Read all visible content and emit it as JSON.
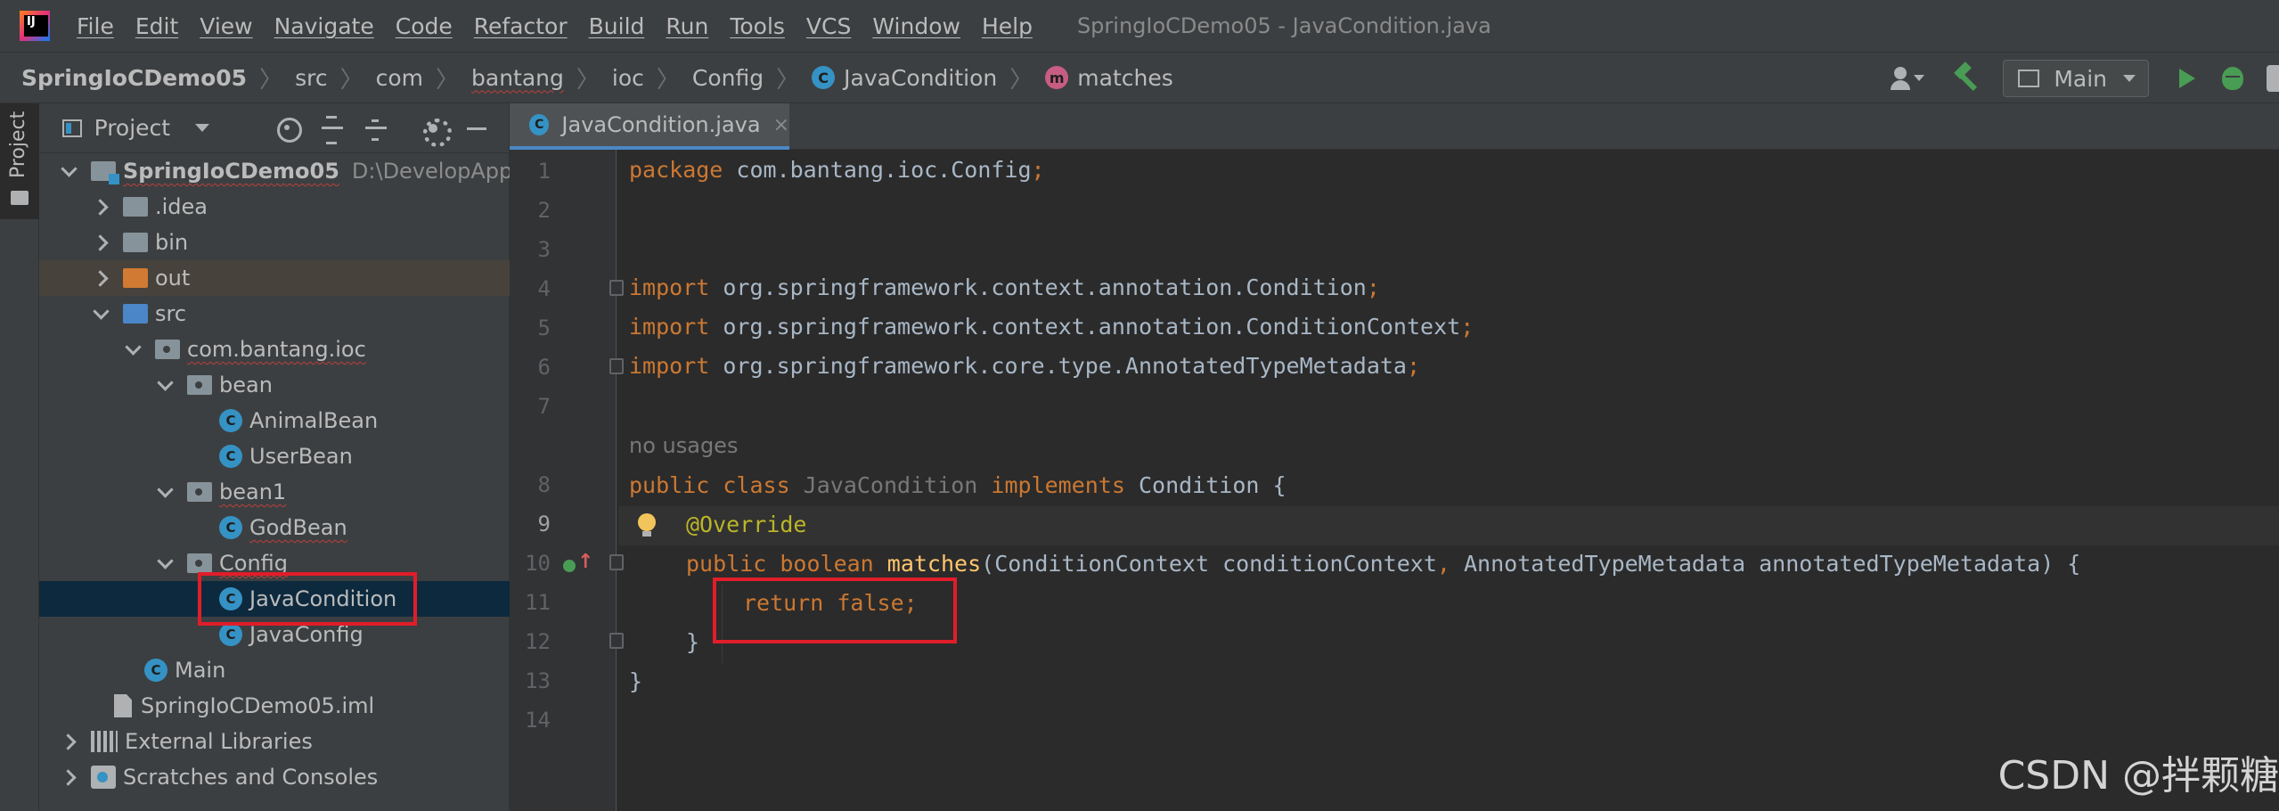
{
  "app": {
    "logo": "intellij-idea-logo",
    "window_title": "SpringIoCDemo05 - JavaCondition.java"
  },
  "menu": [
    "File",
    "Edit",
    "View",
    "Navigate",
    "Code",
    "Refactor",
    "Build",
    "Run",
    "Tools",
    "VCS",
    "Window",
    "Help"
  ],
  "breadcrumbs": {
    "project": "SpringIoCDemo05",
    "src": "src",
    "com": "com",
    "bantang": "bantang",
    "ioc": "ioc",
    "config": "Config",
    "class_icon": "C",
    "class": "JavaCondition",
    "method_icon": "m",
    "method": "matches"
  },
  "toolbar": {
    "run_config": "Main"
  },
  "left_stripe": {
    "label": "Project"
  },
  "project_panel": {
    "title": "Project",
    "tree": {
      "root": {
        "label": "SpringIoCDemo05",
        "path": "D:\\DevelopApplica"
      },
      "idea": ".idea",
      "bin": "bin",
      "out": "out",
      "src": "src",
      "pkg": "com.bantang.ioc",
      "bean": "bean",
      "animal_bean": "AnimalBean",
      "user_bean": "UserBean",
      "bean1": "bean1",
      "god_bean": "GodBean",
      "config": "Config",
      "java_condition": "JavaCondition",
      "java_config": "JavaConfig",
      "main": "Main",
      "iml": "SpringIoCDemo05.iml",
      "ext_libs": "External Libraries",
      "scratches": "Scratches and Consoles",
      "class_badge": "C"
    }
  },
  "editor": {
    "tab_label": "JavaCondition.java",
    "tab_close": "×",
    "line_numbers": [
      "1",
      "2",
      "3",
      "4",
      "5",
      "6",
      "7",
      "8",
      "9",
      "10",
      "11",
      "12",
      "13",
      "14"
    ],
    "code": {
      "l1_kw": "package",
      "l1_rest": " com.bantang.ioc.Config",
      "semi": ";",
      "import_kw": "import",
      "l4_rest": " org.springframework.context.annotation.Condition",
      "l5_rest": " org.springframework.context.annotation.ConditionContext",
      "l6_rest": " org.springframework.core.type.AnnotatedTypeMetadata",
      "usage_hint": "no usages",
      "l8_kw": "public class ",
      "l8_name": "JavaCondition",
      "l8_impl": " implements ",
      "l8_rest": "Condition {",
      "l9_ann": "@Override",
      "l10_kw": "public boolean ",
      "l10_fn": "matches",
      "l10_p1": "(ConditionContext conditionContext",
      "l10_comma": ", ",
      "l10_p2": "AnnotatedTypeMetadata annotatedTypeMetadata) {",
      "l11_kw": "return false;",
      "l12": "}",
      "l13": "}"
    }
  },
  "watermark": "CSDN @拌颗糖"
}
